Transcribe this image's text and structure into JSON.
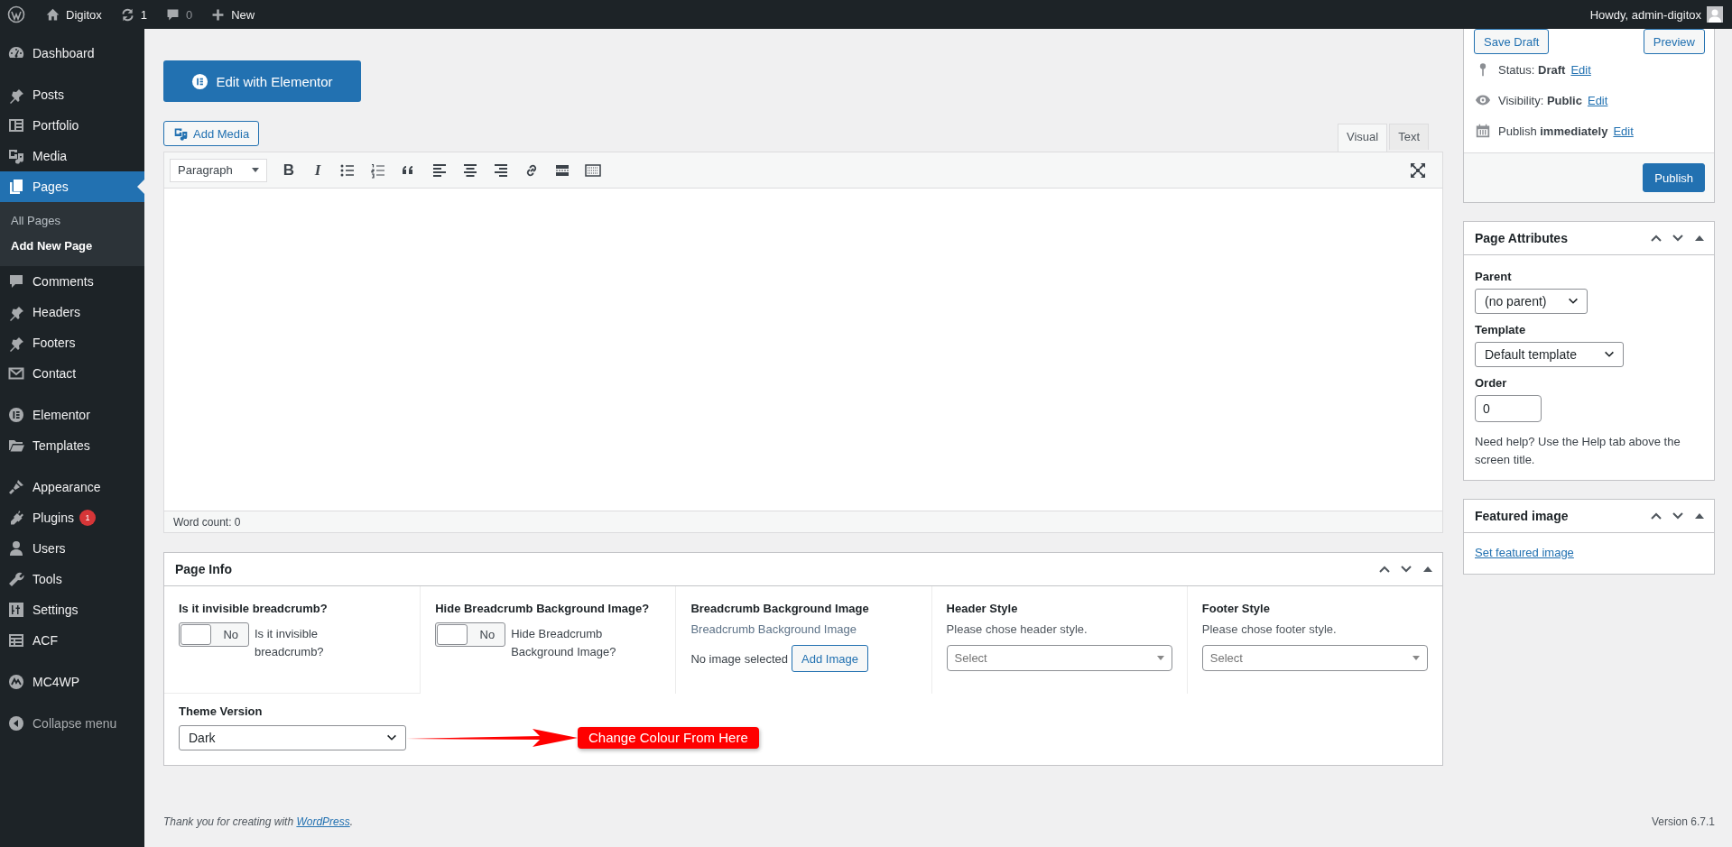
{
  "admin_bar": {
    "site": "Digitox",
    "updates": "1",
    "comments": "0",
    "new": "New",
    "greeting": "Howdy, admin-digitox"
  },
  "sidebar": {
    "groups": [
      [
        {
          "label": "Dashboard",
          "selected": false
        }
      ],
      [
        {
          "label": "Posts",
          "selected": false
        },
        {
          "label": "Portfolio",
          "selected": false
        },
        {
          "label": "Media",
          "selected": false
        },
        {
          "label": "Pages",
          "selected": true,
          "children": [
            {
              "label": "All Pages",
              "selected": false
            },
            {
              "label": "Add New Page",
              "selected": true
            }
          ]
        },
        {
          "label": "Comments",
          "selected": false
        },
        {
          "label": "Headers",
          "selected": false
        },
        {
          "label": "Footers",
          "selected": false
        },
        {
          "label": "Contact",
          "selected": false
        }
      ],
      [
        {
          "label": "Elementor",
          "selected": false
        },
        {
          "label": "Templates",
          "selected": false
        }
      ],
      [
        {
          "label": "Appearance",
          "selected": false
        },
        {
          "label": "Plugins",
          "selected": false,
          "badge": "1"
        },
        {
          "label": "Users",
          "selected": false
        },
        {
          "label": "Tools",
          "selected": false
        },
        {
          "label": "Settings",
          "selected": false
        },
        {
          "label": "ACF",
          "selected": false
        }
      ],
      [
        {
          "label": "MC4WP",
          "selected": false
        }
      ]
    ],
    "collapse": "Collapse menu"
  },
  "editor": {
    "elementor_button": "Edit with Elementor",
    "add_media": "Add Media",
    "tabs": [
      {
        "label": "Visual",
        "selected": true
      },
      {
        "label": "Text",
        "selected": false
      }
    ],
    "format": "Paragraph",
    "toolbar_glyphs": [
      {
        "glyph": "B",
        "kind": "bold"
      },
      {
        "glyph": "I",
        "kind": "italic"
      }
    ],
    "word_count": "Word count: 0"
  },
  "page_info": {
    "title": "Page Info",
    "fields": [
      {
        "kind": "toggle",
        "label": "Is it invisible breadcrumb?",
        "toggle_text": "No",
        "on": false,
        "description": "Is it invisible breadcrumb?"
      },
      {
        "kind": "toggle",
        "label": "Hide Breadcrumb Background Image?",
        "toggle_text": "No",
        "on": false,
        "description": "Hide Breadcrumb Background Image?"
      },
      {
        "kind": "image",
        "label": "Breadcrumb Background Image",
        "description": "Breadcrumb Background Image",
        "status": "No image selected",
        "button": "Add Image"
      },
      {
        "kind": "select",
        "label": "Header Style",
        "description": "Please chose header style.",
        "placeholder": "Select"
      },
      {
        "kind": "select",
        "label": "Footer Style",
        "description": "Please chose footer style.",
        "placeholder": "Select"
      }
    ],
    "theme_version": {
      "label": "Theme Version",
      "value": "Dark"
    },
    "annotation": "Change Colour From Here"
  },
  "publish": {
    "save_draft": "Save Draft",
    "preview": "Preview",
    "rows": [
      {
        "label": "Status:",
        "value": "Draft",
        "link": "Edit"
      },
      {
        "label": "Visibility:",
        "value": "Public",
        "link": "Edit"
      },
      {
        "label": "Publish",
        "value": "immediately",
        "link": "Edit"
      }
    ],
    "button": "Publish"
  },
  "page_attributes": {
    "title": "Page Attributes",
    "parent_label": "Parent",
    "parent": "(no parent)",
    "template_label": "Template",
    "template": "Default template",
    "order_label": "Order",
    "order": "0",
    "help": "Need help? Use the Help tab above the screen title."
  },
  "featured_image": {
    "title": "Featured image",
    "link": "Set featured image"
  },
  "footer": {
    "thanks": "Thank you for creating with ",
    "thanks_link": "WordPress",
    "thanks_end": ".",
    "version": "Version 6.7.1"
  }
}
